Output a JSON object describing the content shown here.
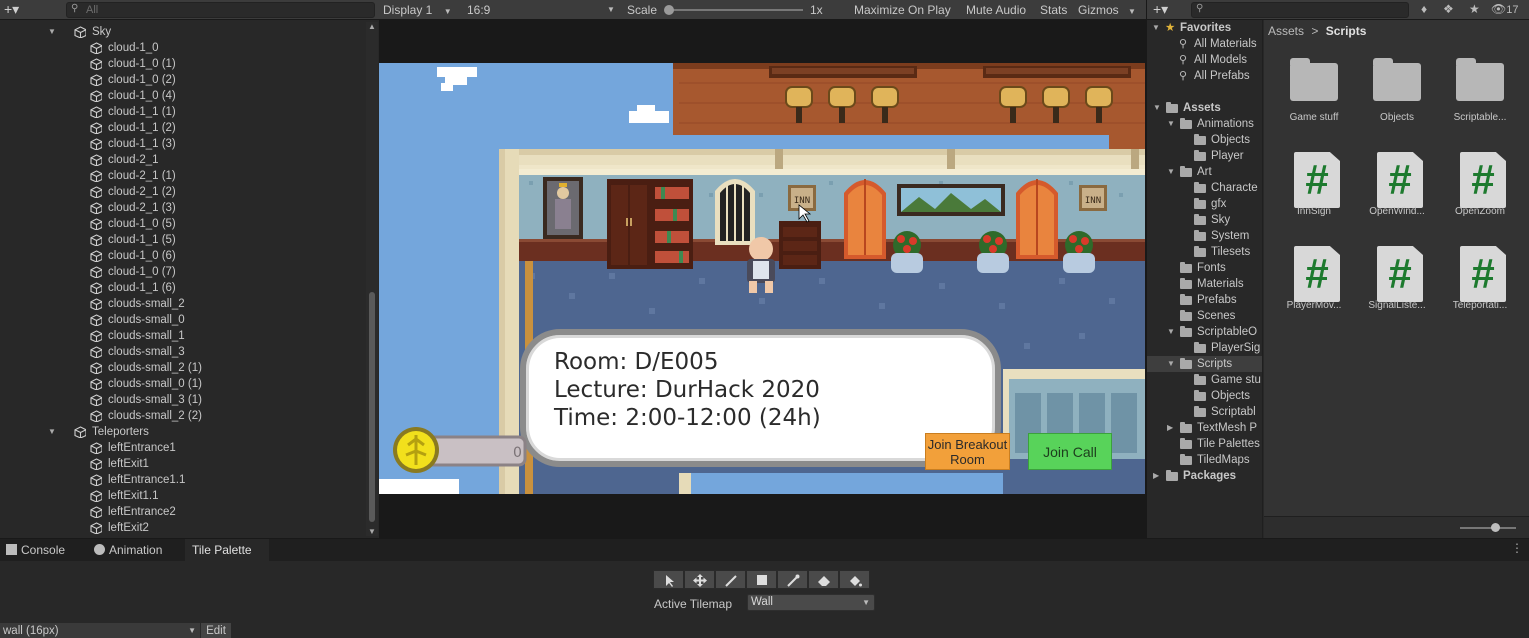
{
  "hierarchy": {
    "add_label": "+▾",
    "search_placeholder": "All",
    "rows": [
      {
        "label": "Sky",
        "indent": 2,
        "expanded": true,
        "type": "group"
      },
      {
        "label": "cloud-1_0",
        "indent": 3,
        "type": "object"
      },
      {
        "label": "cloud-1_0 (1)",
        "indent": 3,
        "type": "object"
      },
      {
        "label": "cloud-1_0 (2)",
        "indent": 3,
        "type": "object"
      },
      {
        "label": "cloud-1_0 (4)",
        "indent": 3,
        "type": "object"
      },
      {
        "label": "cloud-1_1 (1)",
        "indent": 3,
        "type": "object"
      },
      {
        "label": "cloud-1_1 (2)",
        "indent": 3,
        "type": "object"
      },
      {
        "label": "cloud-1_1 (3)",
        "indent": 3,
        "type": "object"
      },
      {
        "label": "cloud-2_1",
        "indent": 3,
        "type": "object"
      },
      {
        "label": "cloud-2_1 (1)",
        "indent": 3,
        "type": "object"
      },
      {
        "label": "cloud-2_1 (2)",
        "indent": 3,
        "type": "object"
      },
      {
        "label": "cloud-2_1 (3)",
        "indent": 3,
        "type": "object"
      },
      {
        "label": "cloud-1_0 (5)",
        "indent": 3,
        "type": "object"
      },
      {
        "label": "cloud-1_1 (5)",
        "indent": 3,
        "type": "object"
      },
      {
        "label": "cloud-1_0 (6)",
        "indent": 3,
        "type": "object"
      },
      {
        "label": "cloud-1_0 (7)",
        "indent": 3,
        "type": "object"
      },
      {
        "label": "cloud-1_1 (6)",
        "indent": 3,
        "type": "object"
      },
      {
        "label": "clouds-small_2",
        "indent": 3,
        "type": "object"
      },
      {
        "label": "clouds-small_0",
        "indent": 3,
        "type": "object"
      },
      {
        "label": "clouds-small_1",
        "indent": 3,
        "type": "object"
      },
      {
        "label": "clouds-small_3",
        "indent": 3,
        "type": "object"
      },
      {
        "label": "clouds-small_2 (1)",
        "indent": 3,
        "type": "object"
      },
      {
        "label": "clouds-small_0 (1)",
        "indent": 3,
        "type": "object"
      },
      {
        "label": "clouds-small_3 (1)",
        "indent": 3,
        "type": "object"
      },
      {
        "label": "clouds-small_2 (2)",
        "indent": 3,
        "type": "object"
      },
      {
        "label": "Teleporters",
        "indent": 2,
        "expanded": true,
        "type": "group"
      },
      {
        "label": "leftEntrance1",
        "indent": 3,
        "type": "object"
      },
      {
        "label": "leftExit1",
        "indent": 3,
        "type": "object"
      },
      {
        "label": "leftEntrance1.1",
        "indent": 3,
        "type": "object"
      },
      {
        "label": "leftExit1.1",
        "indent": 3,
        "type": "object"
      },
      {
        "label": "leftEntrance2",
        "indent": 3,
        "type": "object"
      },
      {
        "label": "leftExit2",
        "indent": 3,
        "type": "object"
      }
    ]
  },
  "game": {
    "display": "Display 1",
    "aspect": "16:9",
    "scale_label": "Scale",
    "scale_value": "1x",
    "scale_fraction": 0.0,
    "maximize": "Maximize On Play",
    "mute": "Mute Audio",
    "stats": "Stats",
    "gizmos": "Gizmos",
    "dialog": {
      "room": "Room: D/E005",
      "lecture": "Lecture: DurHack 2020",
      "time": "Time: 2:00-12:00 (24h)"
    },
    "btn_breakout": "Join Breakout Room",
    "btn_call": "Join Call",
    "sign_text": "INN"
  },
  "project": {
    "add_label": "+▾",
    "hidden_count": "17",
    "favorites_label": "Favorites",
    "favorites": [
      "All Materials",
      "All Models",
      "All Prefabs"
    ],
    "tree": [
      {
        "label": "Assets",
        "indent": 0,
        "expanded": true,
        "bold": true
      },
      {
        "label": "Animations",
        "indent": 1,
        "expanded": true
      },
      {
        "label": "Objects",
        "indent": 2
      },
      {
        "label": "Player",
        "indent": 2
      },
      {
        "label": "Art",
        "indent": 1,
        "expanded": true
      },
      {
        "label": "Characte",
        "indent": 2
      },
      {
        "label": "gfx",
        "indent": 2
      },
      {
        "label": "Sky",
        "indent": 2
      },
      {
        "label": "System",
        "indent": 2
      },
      {
        "label": "Tilesets",
        "indent": 2
      },
      {
        "label": "Fonts",
        "indent": 1
      },
      {
        "label": "Materials",
        "indent": 1
      },
      {
        "label": "Prefabs",
        "indent": 1
      },
      {
        "label": "Scenes",
        "indent": 1
      },
      {
        "label": "ScriptableO",
        "indent": 1,
        "expanded": true
      },
      {
        "label": "PlayerSig",
        "indent": 2
      },
      {
        "label": "Scripts",
        "indent": 1,
        "expanded": true,
        "selected": true
      },
      {
        "label": "Game stu",
        "indent": 2
      },
      {
        "label": "Objects",
        "indent": 2
      },
      {
        "label": "Scriptabl",
        "indent": 2
      },
      {
        "label": "TextMesh P",
        "indent": 1,
        "collapsed": true
      },
      {
        "label": "Tile Palettes",
        "indent": 1
      },
      {
        "label": "TiledMaps",
        "indent": 1
      },
      {
        "label": "Packages",
        "indent": 0,
        "collapsed": true,
        "bold": true
      }
    ],
    "breadcrumb_root": "Assets",
    "breadcrumb_sep": ">",
    "breadcrumb_current": "Scripts",
    "assets": [
      {
        "label": "Game stuff",
        "kind": "folder"
      },
      {
        "label": "Objects",
        "kind": "folder"
      },
      {
        "label": "Scriptable...",
        "kind": "folder"
      },
      {
        "label": "InnSign",
        "kind": "script"
      },
      {
        "label": "OpenWind...",
        "kind": "script"
      },
      {
        "label": "OpenZoom",
        "kind": "script"
      },
      {
        "label": "PlayerMov...",
        "kind": "script"
      },
      {
        "label": "SignalListe...",
        "kind": "script"
      },
      {
        "label": "Teleportati...",
        "kind": "script"
      }
    ],
    "script_glyph": "#",
    "icon_size_fraction": 0.55
  },
  "bottom": {
    "tabs": [
      {
        "label": "Console",
        "icon": "console-icon"
      },
      {
        "label": "Animation",
        "icon": "animation-icon"
      },
      {
        "label": "Tile Palette",
        "icon": "tile-palette-icon",
        "active": true
      }
    ],
    "tools": [
      "select-tool-icon",
      "move-tool-icon",
      "paint-tool-icon",
      "box-fill-tool-icon",
      "pick-tool-icon",
      "erase-tool-icon",
      "flood-fill-tool-icon"
    ],
    "active_tilemap_label": "Active Tilemap",
    "active_tilemap_value": "Wall",
    "palette_value": "wall (16px)",
    "edit_label": "Edit"
  },
  "colors": {
    "accent_orange": "#f2a03a",
    "accent_green": "#58d35a",
    "sky_blue": "#74a6dc",
    "script_hash": "#1d7a2e"
  }
}
